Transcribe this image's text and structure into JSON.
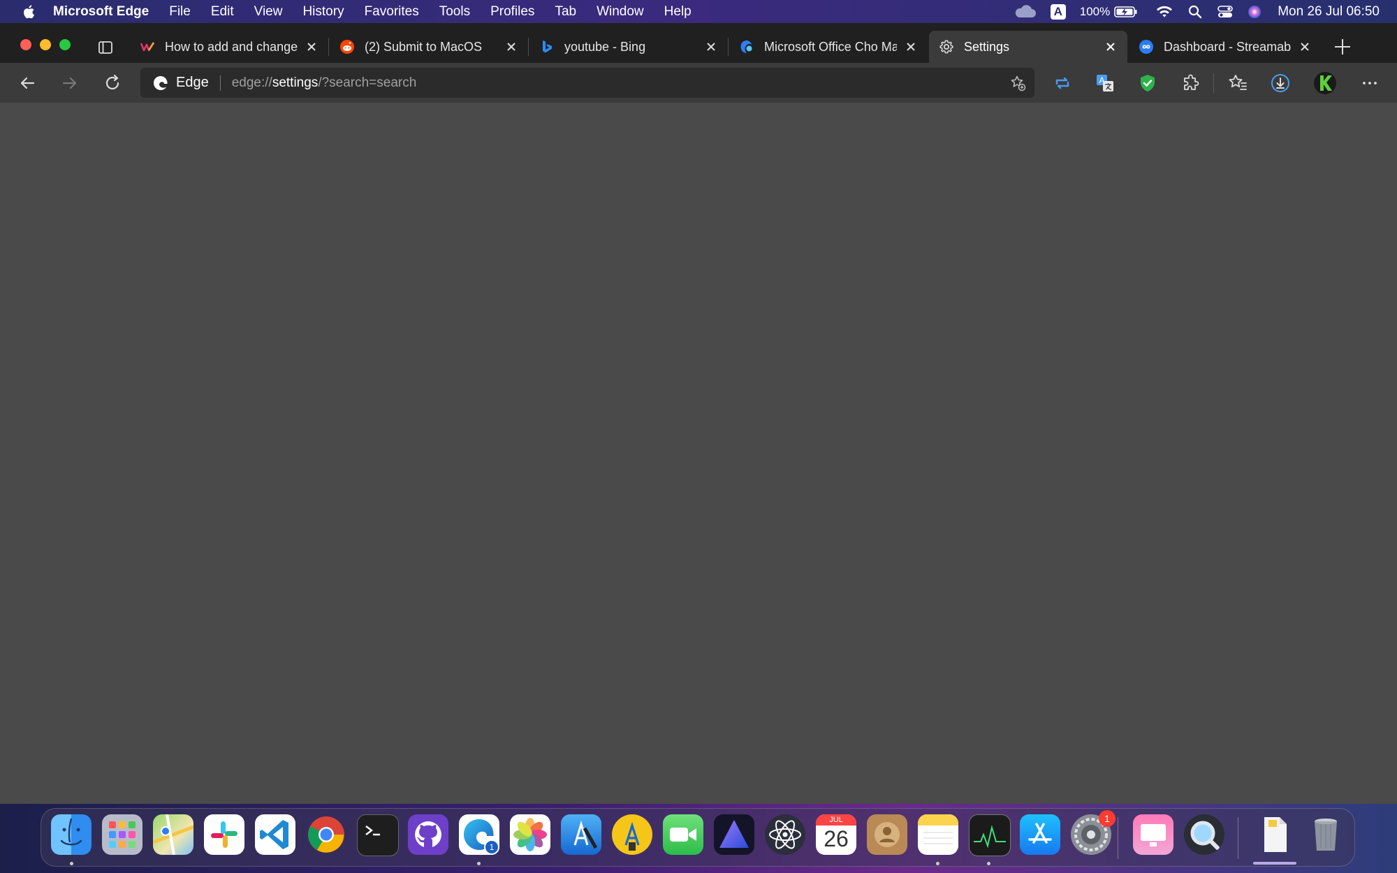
{
  "menubar": {
    "app_name": "Microsoft Edge",
    "menus": [
      "File",
      "Edit",
      "View",
      "History",
      "Favorites",
      "Tools",
      "Profiles",
      "Tab",
      "Window",
      "Help"
    ],
    "battery": "100%",
    "clock": "Mon 26 Jul  06:50",
    "input_source": "A"
  },
  "tabs": [
    {
      "title": "How to add and change",
      "favicon": "webflow-icon",
      "active": false
    },
    {
      "title": "(2) Submit to MacOS",
      "favicon": "reddit-icon",
      "active": false
    },
    {
      "title": "youtube - Bing",
      "favicon": "bing-icon",
      "active": false
    },
    {
      "title": "Microsoft Office Cho Ma",
      "favicon": "office-icon",
      "active": false
    },
    {
      "title": "Settings",
      "favicon": "gear-icon",
      "active": true
    },
    {
      "title": "Dashboard - Streamable",
      "favicon": "streamable-icon",
      "active": false
    }
  ],
  "address_bar": {
    "brand": "Edge",
    "url_prefix": "edge://",
    "url_host": "settings",
    "url_suffix": "/?search=search"
  },
  "dock": {
    "apps": [
      "Finder",
      "Launchpad",
      "Maps",
      "Slack",
      "Visual Studio Code",
      "Google Chrome",
      "Terminal",
      "GitHub Desktop",
      "Microsoft Edge",
      "Photos",
      "Xcode",
      "Instruments",
      "FaceTime",
      "Prism",
      "Atom",
      "Calendar",
      "Contacts",
      "Notes",
      "Activity Monitor",
      "App Store",
      "System Preferences",
      "Screens",
      "QuickTime Player",
      "Documents",
      "Trash"
    ],
    "calendar_month": "JUL",
    "calendar_day": "26",
    "edge_badge": "1",
    "sysprefs_badge": "1"
  },
  "colors": {
    "accent": "#4a9cf0",
    "content_bg": "#4a4a4a",
    "tabstrip_bg": "#202020"
  }
}
